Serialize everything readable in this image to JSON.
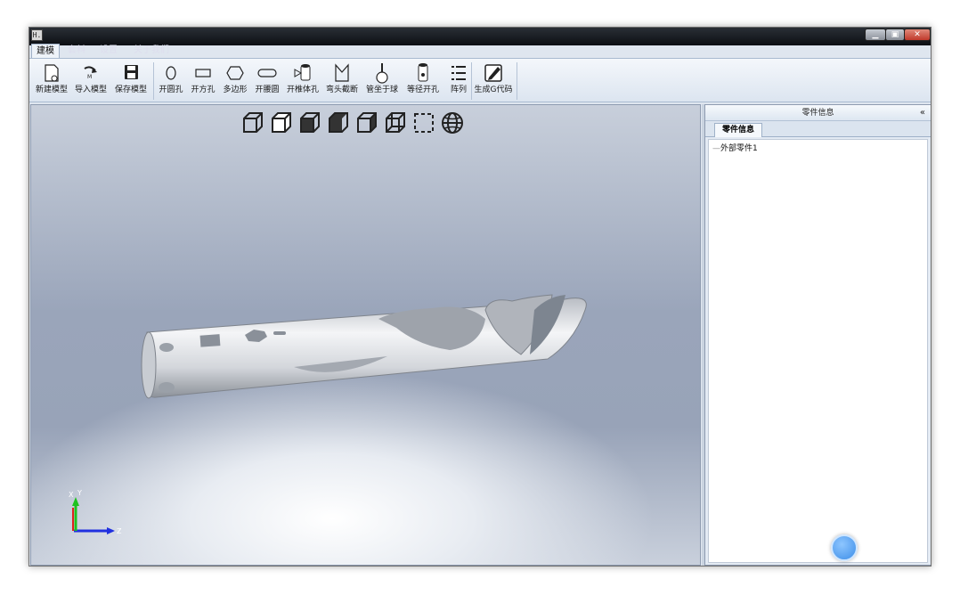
{
  "titlebar": {
    "app_icon_text": "H.",
    "controls": [
      "minimize",
      "maximize",
      "close"
    ]
  },
  "tabs": [
    {
      "label": "建模",
      "active": true
    },
    {
      "label": "套料",
      "active": false
    },
    {
      "label": "设置",
      "active": false
    },
    {
      "label": "关于我们",
      "active": false
    }
  ],
  "ribbon": {
    "buttons": [
      {
        "label": "新建模型",
        "icon": "new-model-icon"
      },
      {
        "label": "导入模型",
        "icon": "import-model-icon"
      },
      {
        "label": "保存模型",
        "icon": "save-icon"
      },
      {
        "label": "开圆孔",
        "icon": "circle-hole-icon"
      },
      {
        "label": "开方孔",
        "icon": "square-hole-icon"
      },
      {
        "label": "多边形",
        "icon": "polygon-icon"
      },
      {
        "label": "开腰圆",
        "icon": "slot-icon"
      },
      {
        "label": "开椎体孔",
        "icon": "cone-hole-icon"
      },
      {
        "label": "弯头截断",
        "icon": "elbow-cut-icon"
      },
      {
        "label": "管坐于球",
        "icon": "pipe-on-ball-icon"
      },
      {
        "label": "等径开孔",
        "icon": "equal-diameter-hole-icon"
      },
      {
        "label": "阵列",
        "icon": "array-icon"
      },
      {
        "label": "生成G代码",
        "icon": "generate-gcode-icon"
      }
    ]
  },
  "viewport": {
    "view_buttons": [
      "iso-view-icon",
      "front-view-icon",
      "left-view-icon",
      "top-view-icon",
      "right-view-icon",
      "back-view-icon",
      "wireframe-view-icon",
      "sphere-view-icon"
    ],
    "axis_labels": {
      "x": "X",
      "y": "Y",
      "z": "Z"
    }
  },
  "panel": {
    "title": "零件信息",
    "collapse": "«",
    "tab": "零件信息",
    "tree_items": [
      "外部零件1"
    ]
  }
}
